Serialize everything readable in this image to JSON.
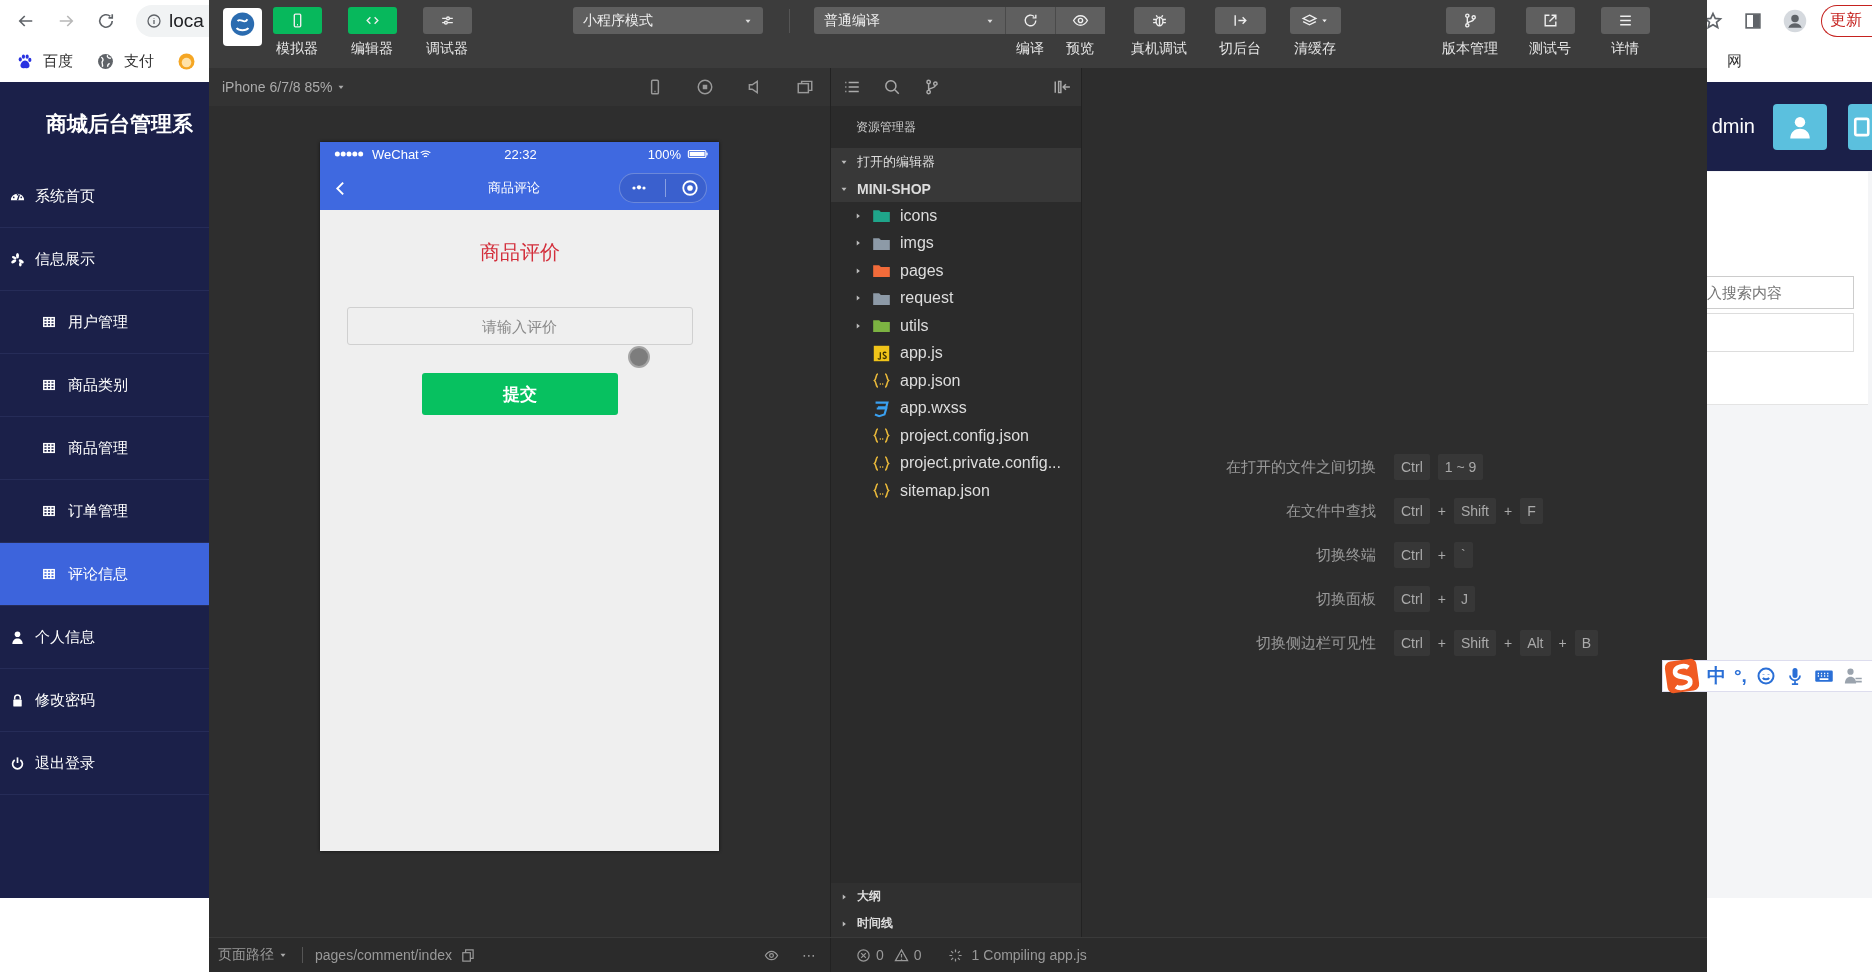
{
  "browser": {
    "address": "loca",
    "bookmarks": [
      {
        "label": "百度"
      },
      {
        "label": "支付"
      }
    ],
    "bookmark_right": "网",
    "update_button": "更新"
  },
  "admin": {
    "title": "商城后台管理系",
    "user": "dmin",
    "menu": [
      {
        "label": "系统首页",
        "selected": false
      },
      {
        "label": "信息展示",
        "selected": false,
        "children": [
          {
            "label": "用户管理",
            "selected": false
          },
          {
            "label": "商品类别",
            "selected": false
          },
          {
            "label": "商品管理",
            "selected": false
          },
          {
            "label": "订单管理",
            "selected": false
          },
          {
            "label": "评论信息",
            "selected": true
          }
        ]
      },
      {
        "label": "个人信息",
        "selected": false
      },
      {
        "label": "修改密码",
        "selected": false
      },
      {
        "label": "退出登录",
        "selected": false
      }
    ],
    "search": {
      "placeholder": "入搜索内容"
    }
  },
  "devtools": {
    "toolbar": {
      "view_buttons": [
        {
          "label": "模拟器",
          "on": true
        },
        {
          "label": "编辑器",
          "on": true
        },
        {
          "label": "调试器",
          "on": false
        }
      ],
      "mode_select": "小程序模式",
      "compile_select": "普通编译",
      "actions": [
        {
          "label": "编译"
        },
        {
          "label": "预览"
        },
        {
          "label": "真机调试"
        },
        {
          "label": "切后台"
        },
        {
          "label": "清缓存"
        }
      ],
      "right_actions": [
        {
          "label": "版本管理"
        },
        {
          "label": "测试号"
        },
        {
          "label": "详情"
        }
      ]
    },
    "simulator": {
      "device": "iPhone 6/7/8 85%",
      "phone": {
        "carrier": "WeChat",
        "time": "22:32",
        "battery": "100%",
        "nav_title": "商品评论",
        "heading": "商品评价",
        "input_placeholder": "请输入评价",
        "submit": "提交"
      }
    },
    "explorer": {
      "title": "资源管理器",
      "sections": [
        {
          "label": "打开的编辑器",
          "expanded": true
        },
        {
          "label": "MINI-SHOP",
          "expanded": true
        }
      ],
      "files": [
        {
          "name": "icons",
          "kind": "folder",
          "color": "#1fa58a",
          "expanded": false
        },
        {
          "name": "imgs",
          "kind": "folder",
          "color": "#8d9aa7",
          "expanded": false
        },
        {
          "name": "pages",
          "kind": "folder",
          "color": "#f26b3a",
          "expanded": false
        },
        {
          "name": "request",
          "kind": "folder",
          "color": "#8d9aa7",
          "expanded": false
        },
        {
          "name": "utils",
          "kind": "folder",
          "color": "#7cb342",
          "expanded": false
        },
        {
          "name": "app.js",
          "kind": "script"
        },
        {
          "name": "app.json",
          "kind": "config"
        },
        {
          "name": "app.wxss",
          "kind": "style"
        },
        {
          "name": "project.config.json",
          "kind": "config"
        },
        {
          "name": "project.private.config...",
          "kind": "config"
        },
        {
          "name": "sitemap.json",
          "kind": "config"
        }
      ],
      "panels": [
        {
          "label": "大纲",
          "expanded": false
        },
        {
          "label": "时间线",
          "expanded": false
        }
      ]
    },
    "shortcuts": [
      {
        "label": "在打开的文件之间切换",
        "keys": [
          {
            "kind": "key",
            "text": "Ctrl"
          },
          {
            "kind": "key",
            "text": "1 ~ 9"
          }
        ]
      },
      {
        "label": "在文件中查找",
        "keys": [
          {
            "kind": "key",
            "text": "Ctrl"
          },
          {
            "kind": "plus",
            "text": "+"
          },
          {
            "kind": "key",
            "text": "Shift"
          },
          {
            "kind": "plus",
            "text": "+"
          },
          {
            "kind": "key",
            "text": "F"
          }
        ]
      },
      {
        "label": "切换终端",
        "keys": [
          {
            "kind": "key",
            "text": "Ctrl"
          },
          {
            "kind": "plus",
            "text": "+"
          },
          {
            "kind": "key",
            "text": "`"
          }
        ]
      },
      {
        "label": "切换面板",
        "keys": [
          {
            "kind": "key",
            "text": "Ctrl"
          },
          {
            "kind": "plus",
            "text": "+"
          },
          {
            "kind": "key",
            "text": "J"
          }
        ]
      },
      {
        "label": "切换侧边栏可见性",
        "keys": [
          {
            "kind": "key",
            "text": "Ctrl"
          },
          {
            "kind": "plus",
            "text": "+"
          },
          {
            "kind": "key",
            "text": "Shift"
          },
          {
            "kind": "plus",
            "text": "+"
          },
          {
            "kind": "key",
            "text": "Alt"
          },
          {
            "kind": "plus",
            "text": "+"
          },
          {
            "kind": "key",
            "text": "B"
          }
        ]
      }
    ],
    "status_bar": {
      "path_label": "页面路径",
      "path": "pages/comment/index",
      "more": "⋯",
      "errors": "0",
      "warnings": "0",
      "message": "1 Compiling app.js"
    }
  },
  "ime": {
    "mode": "中",
    "punctuation": "°,"
  }
}
